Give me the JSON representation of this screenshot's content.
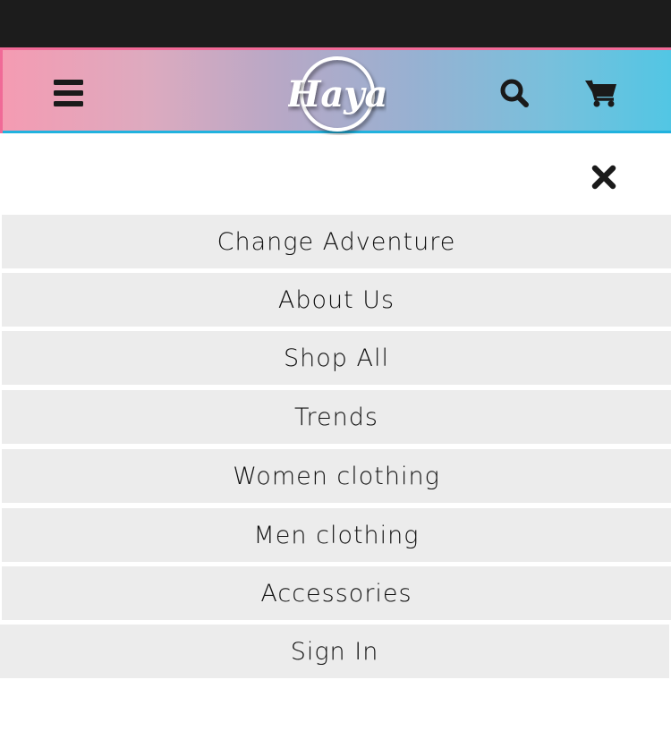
{
  "brand": {
    "logo_text": "Haya"
  },
  "header": {
    "menu_icon": "hamburger-menu-icon",
    "search_icon": "search-icon",
    "cart_icon": "shopping-cart-icon"
  },
  "nav": {
    "close_icon": "close-icon",
    "items": [
      {
        "label": "Change Adventure"
      },
      {
        "label": "About Us"
      },
      {
        "label": "Shop All"
      },
      {
        "label": "Trends"
      },
      {
        "label": "Women clothing"
      },
      {
        "label": "Men clothing"
      },
      {
        "label": "Accessories"
      },
      {
        "label": "Sign In"
      }
    ]
  },
  "colors": {
    "topbar": "#1c1c1c",
    "header_gradient_start": "#f59bb2",
    "header_gradient_end": "#52c6e4",
    "menu_item_bg": "#ececec",
    "text": "#111111"
  }
}
